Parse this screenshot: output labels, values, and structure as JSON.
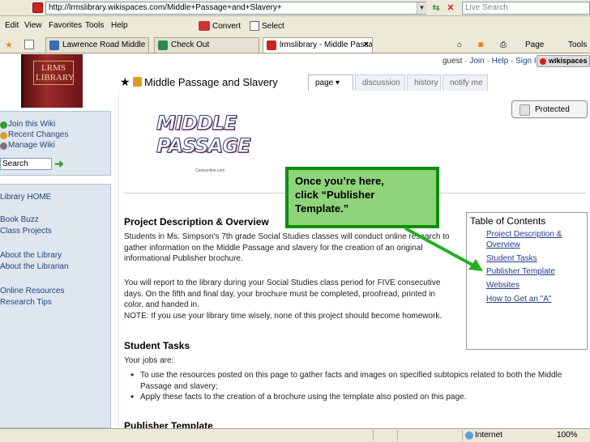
{
  "address_bar": {
    "url": "http://lrmslibrary.wikispaces.com/Middle+Passage+and+Slavery+",
    "search_placeholder": "Live Search"
  },
  "menu": {
    "items": [
      "Edit",
      "View",
      "Favorites",
      "Tools",
      "Help"
    ],
    "convert": "Convert",
    "select": "Select"
  },
  "tabs": [
    {
      "label": "Lawrence Road Middle School",
      "active": false
    },
    {
      "label": "Check Out",
      "active": false
    },
    {
      "label": "lrmslibrary - Middle Passa...",
      "active": true
    }
  ],
  "toolbar_right": {
    "page": "Page",
    "tools": "Tools"
  },
  "header": {
    "logo_text": "LRMS LIBRARY",
    "user_links": {
      "guest": "guest",
      "join": "Join",
      "help": "Help",
      "signin": "Sign In"
    },
    "brand": "wikispaces"
  },
  "page": {
    "title": "Middle Passage and Slavery",
    "tabs": [
      {
        "label": "page",
        "active": true
      },
      {
        "label": "discussion",
        "active": false
      },
      {
        "label": "history",
        "active": false
      },
      {
        "label": "notify me",
        "active": false
      }
    ],
    "protected_label": "Protected",
    "logo_line1": "MIDDLE",
    "logo_line2": "PASSAGE",
    "logo_credit": "Cartoonline.com"
  },
  "sidebar": {
    "links": [
      "Join this Wiki",
      "Recent Changes",
      "Manage Wiki"
    ],
    "search_value": "Search",
    "nav": [
      "Library HOME",
      "Book Buzz",
      "Class Projects",
      "About the Library",
      "About the Librarian",
      "Online Resources",
      "Research Tips"
    ]
  },
  "content": {
    "sec1_title": "Project Description & Overview",
    "sec1_p1": "Students in Ms. Simpson's 7th grade Social Studies classes will conduct online research to gather information on the Middle Passage and slavery for the creation of an original informational Publisher brochure.",
    "sec1_p2": "You will report to the library during your Social Studies class period for FIVE consecutive days. On the fifth and final day, your brochure must be completed, proofread, printed in color, and handed in.",
    "sec1_note": "NOTE: If you use your library time wisely, none of this project should become homework.",
    "sec2_title": "Student Tasks",
    "sec2_intro": "Your jobs are:",
    "sec2_bullets": [
      "To use the resources posted on this page to gather facts and images on specified subtopics related to both the Middle Passage and slavery;",
      "Apply these facts to the creation of a brochure using the template also posted on this page."
    ],
    "sec3_title": "Publisher Template"
  },
  "toc": {
    "title": "Table of Contents",
    "links": [
      "Project Description &",
      "Overview",
      "Student Tasks",
      "Publisher Template",
      "Websites",
      "How to Get an \"A\""
    ]
  },
  "callout": {
    "text": "Once you’re here,\nclick “Publisher\nTemplate.”"
  },
  "statusbar": {
    "zone": "Internet",
    "zoom": "100%"
  }
}
